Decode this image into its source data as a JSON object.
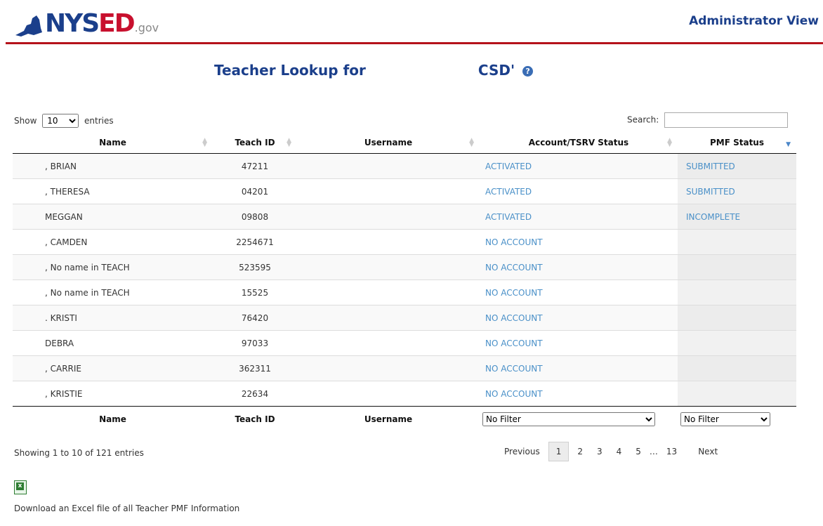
{
  "header": {
    "logo": {
      "nys": "NYS",
      "ed": "ED",
      "gov": ".gov"
    },
    "view_label": "Administrator View"
  },
  "title": {
    "prefix": "Teacher Lookup for",
    "suffix": "CSD'",
    "help_icon": "help-icon"
  },
  "controls": {
    "show_label": "Show",
    "entries_label": "entries",
    "page_size": "10",
    "search_label": "Search:",
    "search_value": ""
  },
  "table": {
    "columns": [
      "Name",
      "Teach ID",
      "Username",
      "Account/TSRV Status",
      "PMF Status"
    ],
    "rows": [
      {
        "name": ", BRIAN",
        "teach_id": "47211",
        "username": "",
        "status": "ACTIVATED",
        "pmf": "SUBMITTED"
      },
      {
        "name": ", THERESA",
        "teach_id": "04201",
        "username": "",
        "status": "ACTIVATED",
        "pmf": "SUBMITTED"
      },
      {
        "name": "MEGGAN",
        "teach_id": "09808",
        "username": "",
        "status": "ACTIVATED",
        "pmf": "INCOMPLETE"
      },
      {
        "name": ", CAMDEN",
        "teach_id": "2254671",
        "username": "",
        "status": "NO ACCOUNT",
        "pmf": ""
      },
      {
        "name": ", No name in TEACH",
        "teach_id": "523595",
        "username": "",
        "status": "NO ACCOUNT",
        "pmf": ""
      },
      {
        "name": ", No name in TEACH",
        "teach_id": "15525",
        "username": "",
        "status": "NO ACCOUNT",
        "pmf": ""
      },
      {
        "name": ". KRISTI",
        "teach_id": "76420",
        "username": "",
        "status": "NO ACCOUNT",
        "pmf": ""
      },
      {
        "name": "DEBRA",
        "teach_id": "97033",
        "username": "",
        "status": "NO ACCOUNT",
        "pmf": ""
      },
      {
        "name": ", CARRIE",
        "teach_id": "362311",
        "username": "",
        "status": "NO ACCOUNT",
        "pmf": ""
      },
      {
        "name": ", KRISTIE",
        "teach_id": "22634",
        "username": "",
        "status": "NO ACCOUNT",
        "pmf": ""
      }
    ],
    "footer": {
      "name": "Name",
      "teach_id": "Teach ID",
      "username": "Username",
      "status_filter": "No Filter",
      "pmf_filter": "No Filter"
    }
  },
  "info": "Showing 1 to 10 of 121 entries",
  "pagination": {
    "previous": "Previous",
    "pages": [
      "1",
      "2",
      "3",
      "4",
      "5"
    ],
    "ellipsis": "…",
    "last": "13",
    "next": "Next",
    "current": "1"
  },
  "download": {
    "icon": "excel-icon",
    "label": "Download an Excel file of all Teacher PMF Information"
  }
}
